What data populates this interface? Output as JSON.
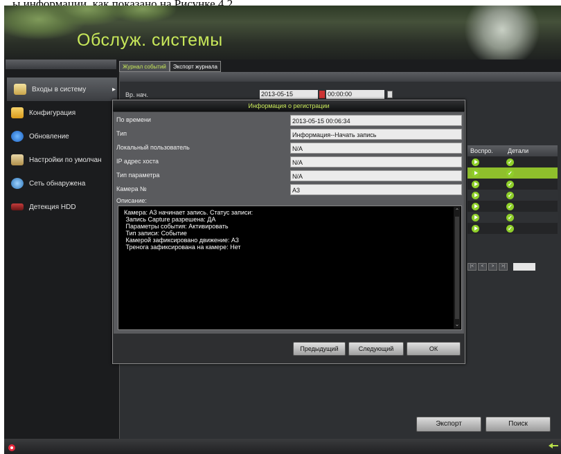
{
  "doc_caption": "ы информации, как показано на Рисунке 4.2.",
  "header": {
    "title": "Обслуж. системы"
  },
  "tabs": [
    {
      "label": "Журнал событий",
      "active": true
    },
    {
      "label": "Экспорт журнала",
      "active": false
    }
  ],
  "sidebar": {
    "items": [
      {
        "label": "Входы в систему",
        "icon": "notepad-icon",
        "active": true
      },
      {
        "label": "Конфигурация",
        "icon": "folder-icon",
        "active": false
      },
      {
        "label": "Обновление",
        "icon": "upgrade-arrow-icon",
        "active": false
      },
      {
        "label": "Настройки по умолчан",
        "icon": "reset-box-icon",
        "active": false
      },
      {
        "label": "Сеть обнаружена",
        "icon": "network-icon",
        "active": false
      },
      {
        "label": "Детекция HDD",
        "icon": "hdd-icon",
        "active": false
      }
    ]
  },
  "background": {
    "start_label": "Вр. нач.",
    "start_date": "2013-05-15",
    "start_time": "00:00:00",
    "results_headers": {
      "play": "Воспро.",
      "details": "Детали"
    },
    "row_count": 7,
    "selected_row": 1
  },
  "dialog": {
    "title": "Информация о регистрации",
    "fields": [
      {
        "label": "По времени",
        "value": "2013-05-15 00:06:34"
      },
      {
        "label": "Тип",
        "value": "Информация--Начать запись"
      },
      {
        "label": "Локальный пользователь",
        "value": "N/A"
      },
      {
        "label": "IP адрес хоста",
        "value": "N/A"
      },
      {
        "label": "Тип параметра",
        "value": "N/A"
      },
      {
        "label": "Камера №",
        "value": "A3"
      }
    ],
    "description_label": "Описание:",
    "description": "Камера: А3 начинает запись. Статус записи:\n Запись Capture разрешена: ДА\n Параметры события: Активировать\n Тип записи: Событие\n Камерой зафиксировано движение: А3\n Тренога зафиксирована на камере: Нет",
    "buttons": {
      "prev": "Предыдущий",
      "next": "Следующий",
      "ok": "ОК"
    }
  },
  "bottom_buttons": {
    "export": "Экспорт",
    "search": "Поиск"
  },
  "colors": {
    "accent": "#c8e85a",
    "selected_row": "#8fbf2c",
    "record": "#e8283c"
  }
}
